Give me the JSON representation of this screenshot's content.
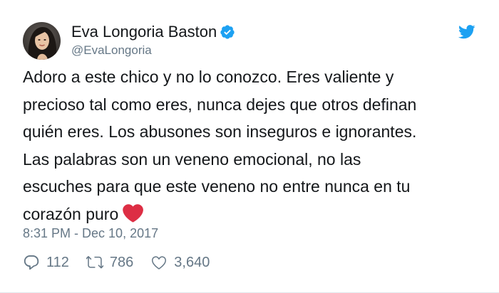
{
  "user": {
    "name": "Eva Longoria Baston",
    "handle": "@EvaLongoria",
    "verified": true
  },
  "tweet": {
    "lines": [
      "Adoro a este chico y no lo conozco. Eres valiente y",
      "precioso tal como eres, nunca dejes que otros definan",
      "quién eres. Los abusones son inseguros e ignorantes.",
      "Las palabras son un veneno emocional, no las",
      "escuches para que este veneno no entre nunca en tu",
      "corazón puro"
    ],
    "emoji": "red-heart",
    "timestamp": "8:31 PM - Dec 10, 2017"
  },
  "actions": {
    "replies": "112",
    "retweets": "786",
    "likes": "3,640"
  },
  "icons": [
    "verified-badge-icon",
    "twitter-bird-icon",
    "reply-icon",
    "retweet-icon",
    "like-icon",
    "red-heart-emoji-icon"
  ],
  "colors": {
    "twitter_blue": "#1da1f2",
    "muted_text": "#657786",
    "primary_text": "#14171a",
    "heart_red": "#dd2e44"
  }
}
